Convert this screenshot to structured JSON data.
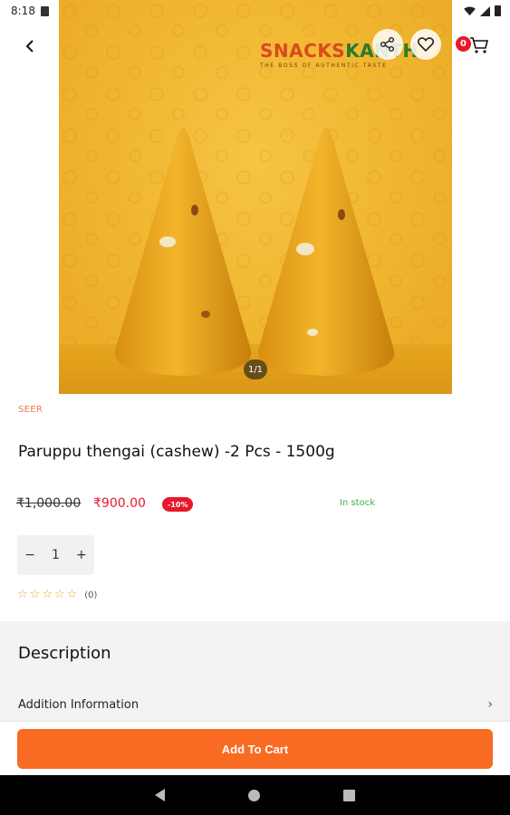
{
  "status_bar": {
    "time": "8:18"
  },
  "product": {
    "category": "SEER",
    "title": "Paruppu thengai (cashew) -2 Pcs  -  1500g",
    "old_price": "₹1,000.00",
    "new_price": "₹900.00",
    "discount": "-10%",
    "stock_status": "In stock",
    "quantity": "1",
    "rating_value": 0,
    "rating_count": "(0)"
  },
  "gallery": {
    "counter": "1/1"
  },
  "brand": {
    "name_left": "SNACKS",
    "name_right": "KANTH",
    "tagline": "THE BOSS OF AUTHENTIC TASTE"
  },
  "header": {
    "cart_count": "0"
  },
  "sections": {
    "description_title": "Description",
    "additional_info_label": "Addition Information"
  },
  "actions": {
    "add_to_cart_label": "Add To Cart",
    "decrement_label": "−",
    "increment_label": "+"
  },
  "colors": {
    "accent": "#f96a22",
    "price_red": "#e8182b",
    "stock_green": "#3fae4a",
    "star": "#e8a830"
  },
  "icons": [
    "back-arrow-icon",
    "share-icon",
    "heart-icon",
    "cart-icon",
    "star-outline-icon",
    "chevron-right-icon"
  ]
}
